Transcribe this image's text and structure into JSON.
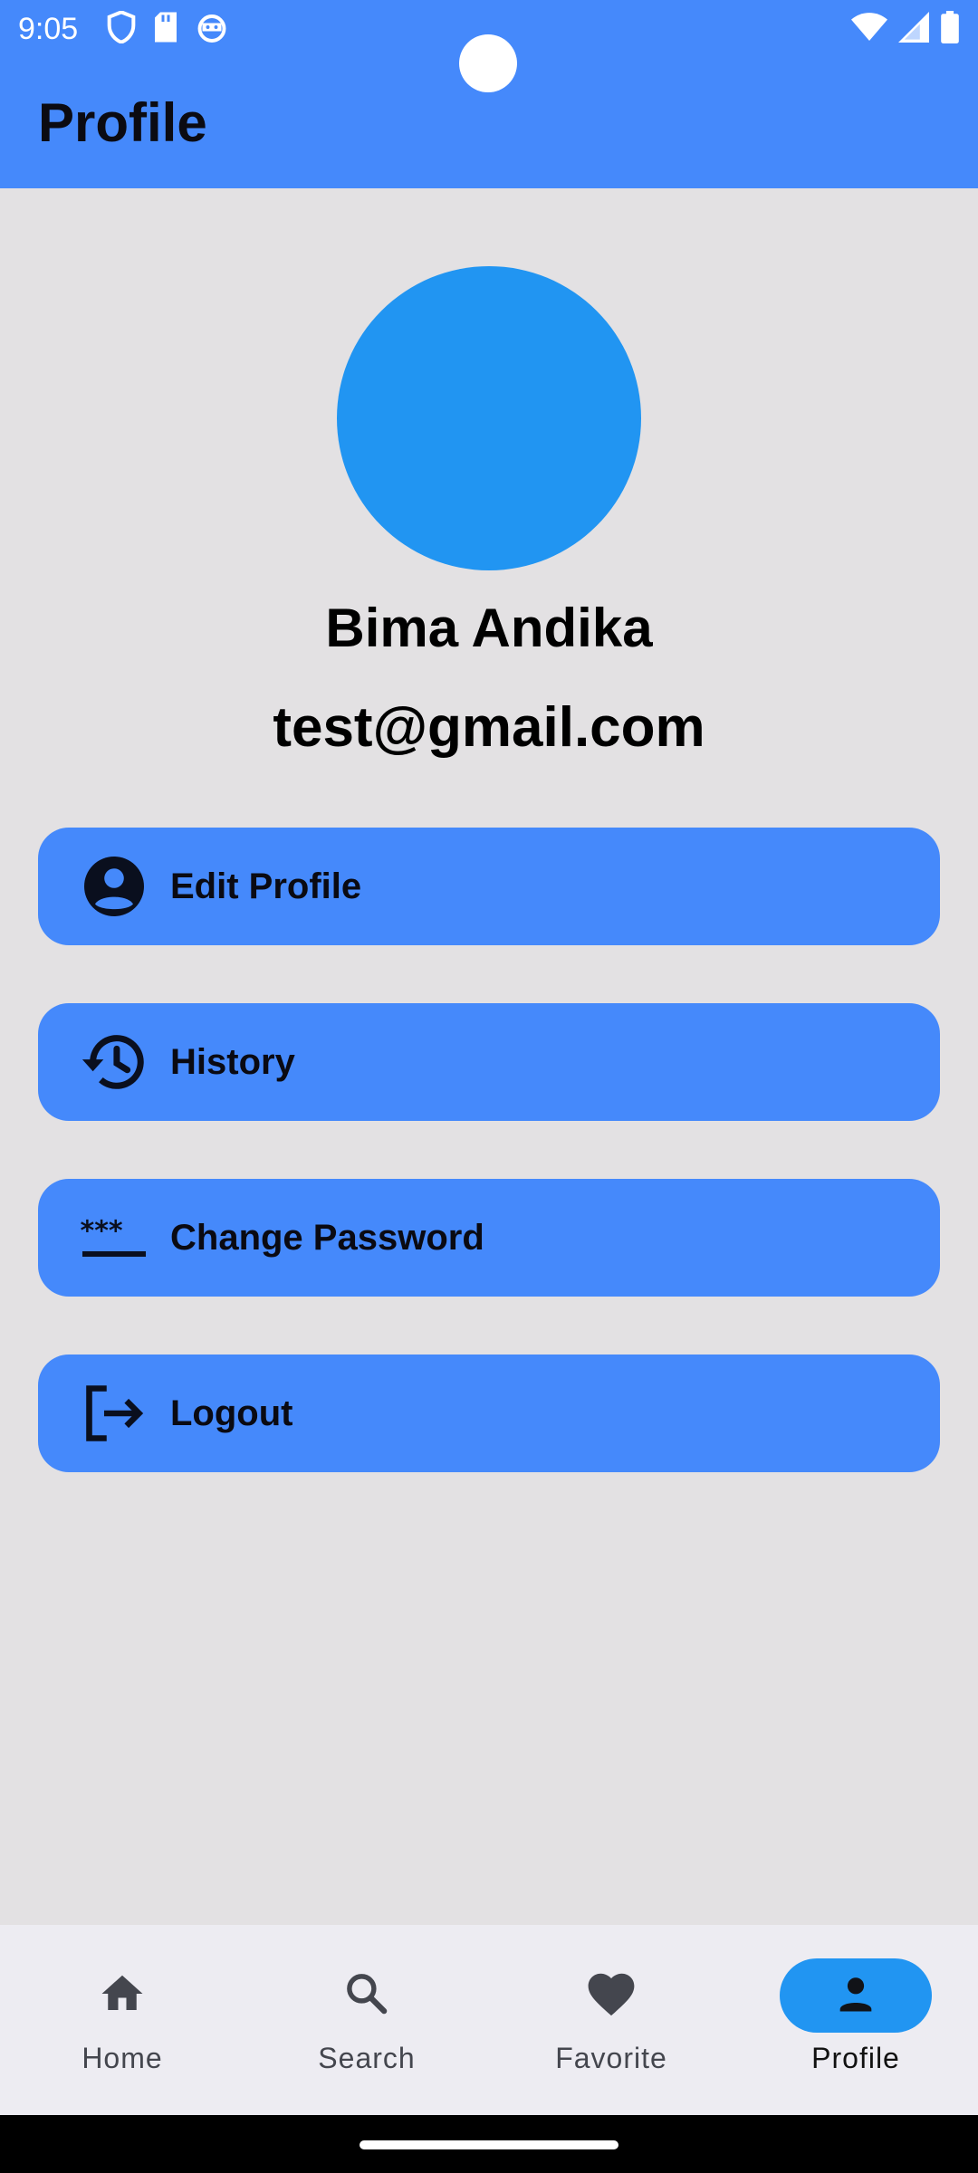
{
  "status_bar": {
    "time": "9:05",
    "left_icons": [
      "shield-icon",
      "sd-card-icon",
      "android-debug-icon"
    ],
    "right_icons": [
      "wifi-icon",
      "signal-icon",
      "battery-icon"
    ]
  },
  "app_bar": {
    "title": "Profile",
    "background": "#4589fb"
  },
  "profile": {
    "avatar_color": "#2195f2",
    "name": "Bima Andika",
    "email": "test@gmail.com"
  },
  "menu": {
    "items": [
      {
        "label": "Edit Profile",
        "icon": "account-circle-icon"
      },
      {
        "label": "History",
        "icon": "history-icon"
      },
      {
        "label": "Change Password",
        "icon": "password-icon"
      },
      {
        "label": "Logout",
        "icon": "logout-icon"
      }
    ],
    "button_color": "#4589fb"
  },
  "bottom_nav": {
    "items": [
      {
        "label": "Home",
        "icon": "home-icon",
        "active": false
      },
      {
        "label": "Search",
        "icon": "search-icon",
        "active": false
      },
      {
        "label": "Favorite",
        "icon": "heart-icon",
        "active": false
      },
      {
        "label": "Profile",
        "icon": "person-icon",
        "active": true
      }
    ],
    "active_color": "#2195f2"
  }
}
